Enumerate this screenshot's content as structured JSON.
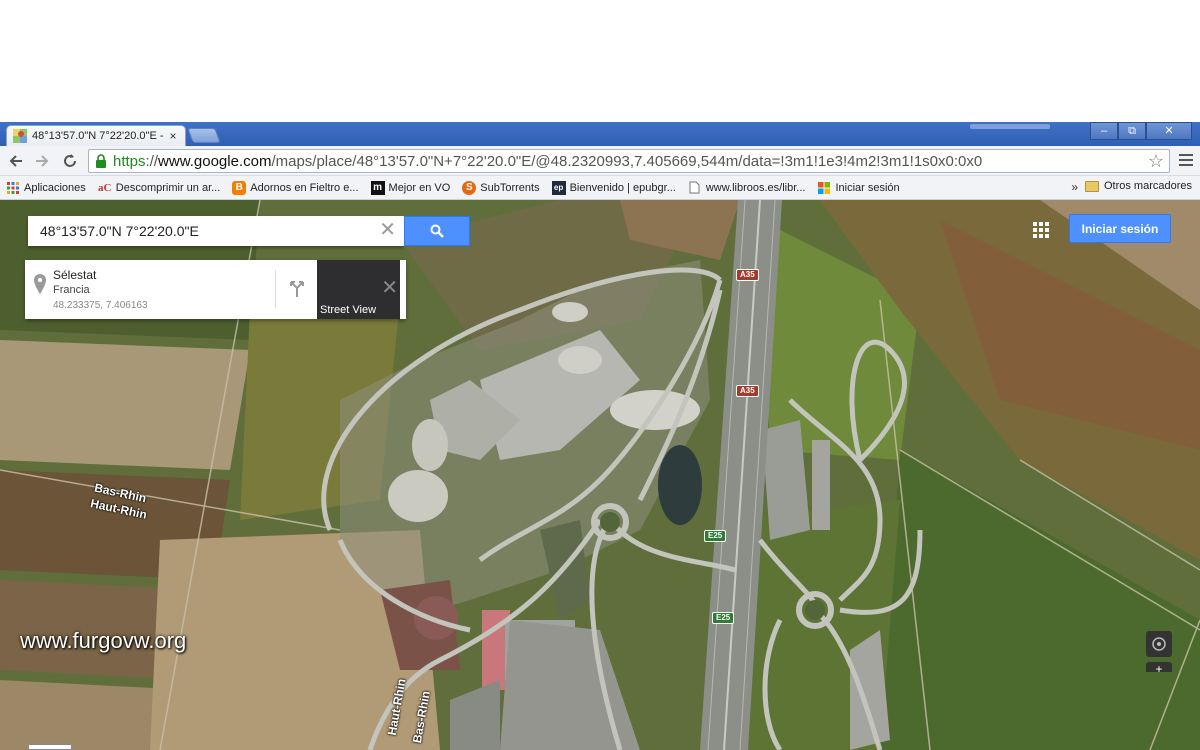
{
  "browser": {
    "tab_title": "48°13'57.0\"N 7°22'20.0\"E -",
    "tab_close": "×",
    "url_scheme": "https",
    "url_sep": "://",
    "url_host": "www.google.com",
    "url_path": "/maps/place/48°13'57.0\"N+7°22'20.0\"E/@48.2320993,7.405669,544m/data=!3m1!1e3!4m2!3m1!1s0x0:0x0",
    "window_buttons": [
      "–",
      "⧉",
      "✕"
    ]
  },
  "bookmarks": {
    "items": [
      {
        "label": "Aplicaciones",
        "icon": "apps-grid-icon"
      },
      {
        "label": "Descomprimir un ar...",
        "icon": "ac-logo-icon"
      },
      {
        "label": "Adornos en Fieltro e...",
        "icon": "blogger-icon"
      },
      {
        "label": "Mejor en VO",
        "icon": "m-logo-icon"
      },
      {
        "label": "SubTorrents",
        "icon": "subtorrents-icon"
      },
      {
        "label": "Bienvenido | epubgr...",
        "icon": "epub-icon"
      },
      {
        "label": "www.libroos.es/libr...",
        "icon": "page-icon"
      },
      {
        "label": "Iniciar sesión",
        "icon": "windows-icon"
      }
    ],
    "more": "»",
    "other_label": "Otros marcadores"
  },
  "maps": {
    "search_query": "48°13'57.0\"N 7°22'20.0\"E",
    "place_name": "Sélestat",
    "place_country": "Francia",
    "place_coords": "48.233375, 7.406163",
    "street_view_label": "Street View",
    "signin_label": "Iniciar sesión",
    "labels": {
      "bas_rhin_left": "Bas-Rhin",
      "haut_rhin_left": "Haut-Rhin",
      "haut_rhin_bottom": "Haut-Rhin",
      "bas_rhin_bottom": "Bas-Rhin"
    },
    "shields": {
      "a35_top": "A35",
      "a35_mid": "A35",
      "e25_a": "E25",
      "e25_b": "E25"
    },
    "zoom_in": "+"
  },
  "watermark": "www.furgovw.org",
  "colors": {
    "accent_blue": "#4d90fe",
    "chrome_frame": "#3f72c6",
    "https_green": "#1e8c1e"
  }
}
